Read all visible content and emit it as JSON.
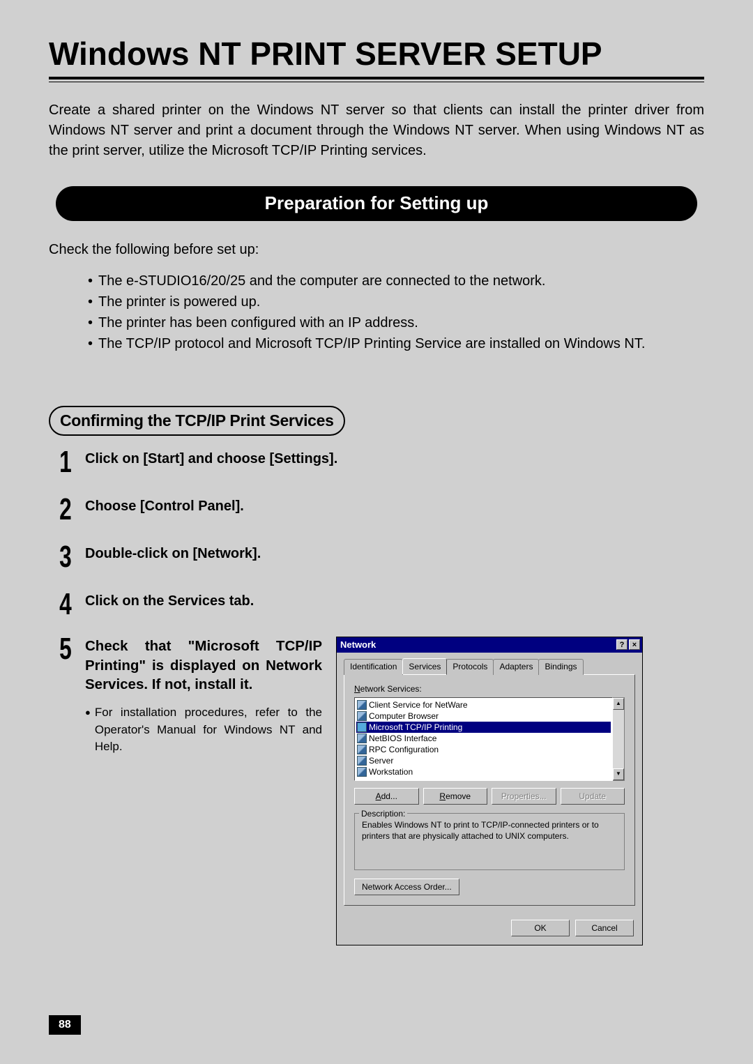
{
  "page_title": "Windows NT PRINT SERVER SETUP",
  "intro": "Create a shared printer on the Windows NT server so that clients can install the printer driver from Windows NT server and print a document through the Windows NT server.\nWhen using Windows NT as the print server, utilize the Microsoft TCP/IP Printing services.",
  "section_banner": "Preparation for Setting up",
  "check_text": "Check the following before set up:",
  "bullets": [
    "The e-STUDIO16/20/25 and the computer are connected to the network.",
    "The printer is powered up.",
    "The printer has been configured with an IP address.",
    "The TCP/IP protocol and Microsoft TCP/IP Printing Service are installed on Windows NT."
  ],
  "subheading": "Confirming the TCP/IP Print Services",
  "steps": [
    {
      "n": "1",
      "title": "Click on [Start] and choose [Settings]."
    },
    {
      "n": "2",
      "title": "Choose [Control Panel]."
    },
    {
      "n": "3",
      "title": "Double-click on [Network]."
    },
    {
      "n": "4",
      "title": "Click on the Services tab."
    },
    {
      "n": "5",
      "title": "Check that \"Microsoft TCP/IP Printing\" is displayed on Network Services. If not, install it.",
      "note": "For installation procedures, refer to the Operator's Manual for Windows NT and Help."
    }
  ],
  "dialog": {
    "title": "Network",
    "tabs": [
      "Identification",
      "Services",
      "Protocols",
      "Adapters",
      "Bindings"
    ],
    "active_tab": 1,
    "list_label_pre": "N",
    "list_label_post": "etwork Services:",
    "services": [
      {
        "name": "Client Service for NetWare",
        "selected": false
      },
      {
        "name": "Computer Browser",
        "selected": false
      },
      {
        "name": "Microsoft TCP/IP Printing",
        "selected": true
      },
      {
        "name": "NetBIOS Interface",
        "selected": false
      },
      {
        "name": "RPC Configuration",
        "selected": false
      },
      {
        "name": "Server",
        "selected": false
      },
      {
        "name": "Workstation",
        "selected": false
      }
    ],
    "buttons": {
      "add": "Add...",
      "remove": "Remove",
      "properties": "Properties...",
      "update": "Update"
    },
    "desc_label": "Description:",
    "desc_text": "Enables Windows NT to print to TCP/IP-connected printers or to printers that are physically attached to UNIX computers.",
    "nao_btn": "Network Access Order...",
    "ok": "OK",
    "cancel": "Cancel"
  },
  "page_number": "88"
}
